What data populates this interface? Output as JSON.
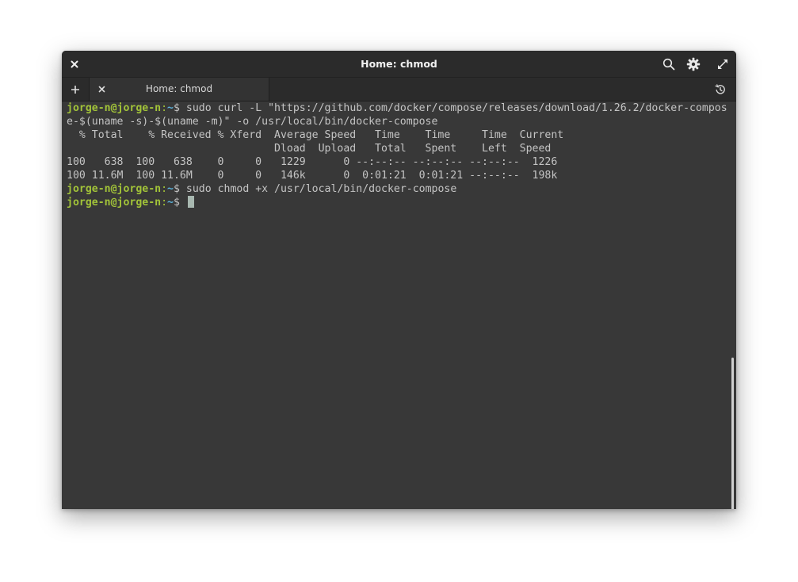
{
  "window": {
    "title": "Home: chmod"
  },
  "titlebar": {
    "close_icon": "close-icon",
    "search_icon": "search-icon",
    "settings_icon": "gear-icon",
    "maximize_icon": "maximize-icon"
  },
  "tabs": {
    "add_icon": "plus-icon",
    "history_icon": "history-icon",
    "items": [
      {
        "label": "Home: chmod",
        "active": true
      }
    ]
  },
  "terminal": {
    "prompt_user": "jorge-n@jorge-n",
    "prompt_sep": ":",
    "prompt_dir": "~",
    "prompt_symbol": "$ ",
    "lines": [
      {
        "type": "prompt",
        "cmd": "sudo curl -L \"https://github.com/docker/compose/releases/download/1.26.2/docker-compos"
      },
      {
        "type": "output",
        "text": "e-$(uname -s)-$(uname -m)\" -o /usr/local/bin/docker-compose"
      },
      {
        "type": "output",
        "text": "  % Total    % Received % Xferd  Average Speed   Time    Time     Time  Current"
      },
      {
        "type": "output",
        "text": "                                 Dload  Upload   Total   Spent    Left  Speed"
      },
      {
        "type": "output",
        "text": "100   638  100   638    0     0   1229      0 --:--:-- --:--:-- --:--:--  1226"
      },
      {
        "type": "output",
        "text": "100 11.6M  100 11.6M    0     0   146k      0  0:01:21  0:01:21 --:--:--  198k"
      },
      {
        "type": "prompt",
        "cmd": "sudo chmod +x /usr/local/bin/docker-compose"
      },
      {
        "type": "prompt",
        "cmd": "",
        "cursor": true
      }
    ]
  },
  "colors": {
    "prompt_user": "#a2c339",
    "prompt_dir": "#5ab0d8",
    "text": "#c4c4c4",
    "background": "#383838"
  }
}
